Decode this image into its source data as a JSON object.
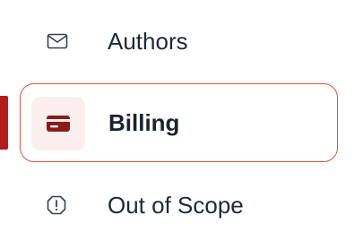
{
  "sidebar": {
    "items": [
      {
        "label": "Authors",
        "icon": "envelope-icon",
        "active": false
      },
      {
        "label": "Billing",
        "icon": "credit-card-icon",
        "active": true
      },
      {
        "label": "Out of Scope",
        "icon": "alert-octagon-icon",
        "active": false
      }
    ]
  },
  "colors": {
    "accent": "#b31d1d",
    "active_border": "#d9553a",
    "active_icon_bg": "#fbefed",
    "text": "#1f2937",
    "icon_muted": "#374151"
  }
}
